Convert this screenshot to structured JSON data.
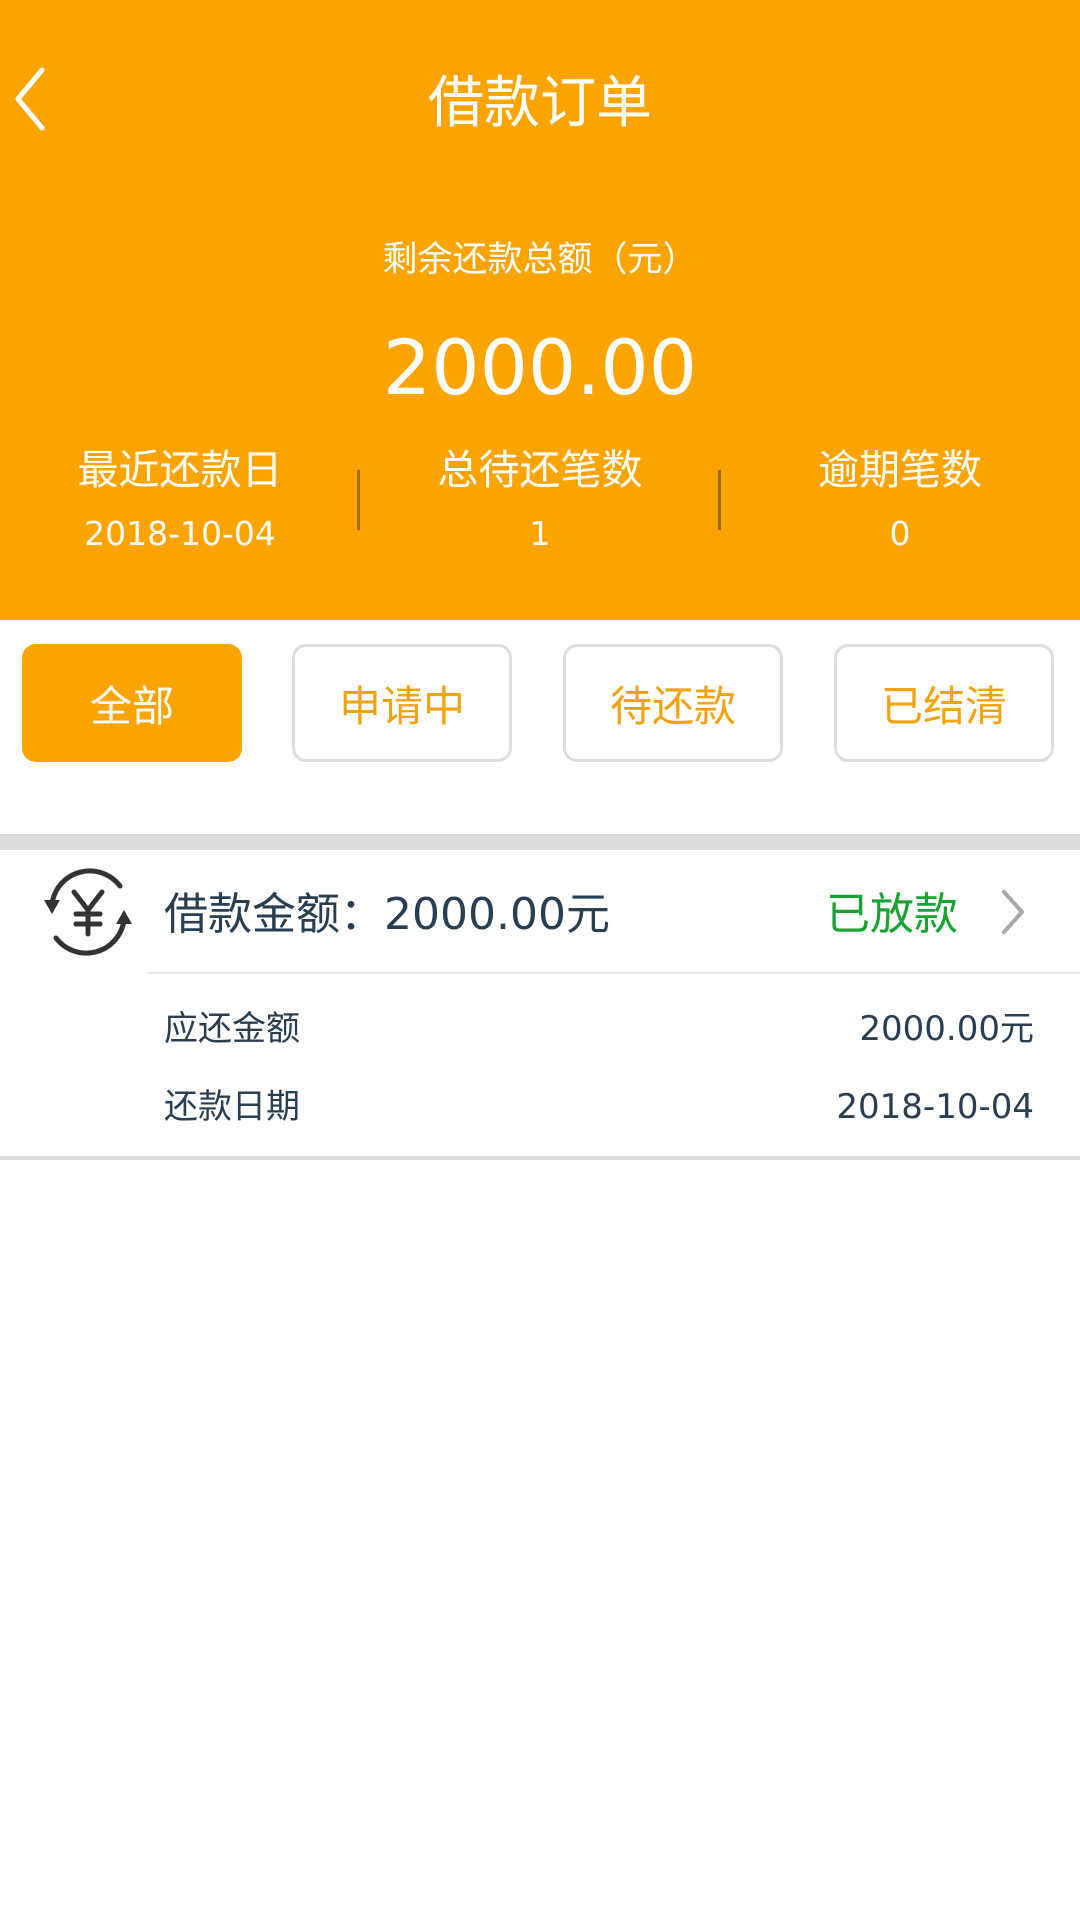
{
  "header": {
    "title": "借款订单",
    "subtitle": "剩余还款总额（元）",
    "total_amount": "2000.00",
    "stats": [
      {
        "label": "最近还款日",
        "value": "2018-10-04"
      },
      {
        "label": "总待还笔数",
        "value": "1"
      },
      {
        "label": "逾期笔数",
        "value": "0"
      }
    ]
  },
  "filters": [
    {
      "label": "全部",
      "active": true
    },
    {
      "label": "申请中",
      "active": false
    },
    {
      "label": "待还款",
      "active": false
    },
    {
      "label": "已结清",
      "active": false
    }
  ],
  "order": {
    "icon": "yen-cycle-icon",
    "amount_text": "借款金额：2000.00元",
    "status": "已放款",
    "rows": [
      {
        "label": "应还金额",
        "value": "2000.00元"
      },
      {
        "label": "还款日期",
        "value": "2018-10-04"
      }
    ]
  },
  "colors": {
    "accent": "#fba400",
    "status_green": "#1aa234",
    "text_dark": "#2b3e50"
  }
}
